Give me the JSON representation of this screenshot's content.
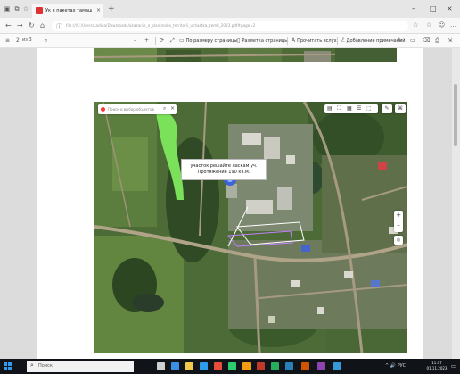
{
  "browser": {
    "tab": {
      "title": "Ук в пакетах тамаш ждй",
      "close": "×"
    },
    "new_tab": "+",
    "window": {
      "minimize": "–",
      "maximize": "□",
      "close": "×"
    },
    "nav": {
      "back": "←",
      "forward": "→",
      "reload": "↻",
      "home": "⌂"
    },
    "url": "file:///C:/Users/Ladina/Downloads/ukazanie_o_planirovke_territorii_uchastka_zemli_2023.pdf#page=2",
    "url_icons": {
      "lock": "ⓘ",
      "star": "☆",
      "collections": "☆"
    },
    "right_icons": {
      "profile": "☺",
      "settings": "…"
    }
  },
  "pdf_toolbar": {
    "menu_glyph": "≡",
    "page_current": "2",
    "page_total": "из 3",
    "search_glyph": "⌕",
    "zoom_out": "–",
    "zoom_in": "+",
    "rotate": "⟳",
    "fit": "⤢",
    "fit_page": "По размеру страницы",
    "page_view": "Разметка страницы",
    "read_aloud": "Прочитать вслух",
    "add_text": "Добавление примечаний",
    "draw": "✎",
    "highlight": "▭",
    "erase": "⌫",
    "print": "⎙",
    "save": "💾",
    "pin": "⇲"
  },
  "map": {
    "search_placeholder": "Поиск и выбор объектов",
    "search_icon": "⌕",
    "clear_icon": "×",
    "label_line1": "участок решайте ласкам уч.",
    "label_line2": "Протяжение 190 кв.м.",
    "zoom_in": "+",
    "zoom_out": "–",
    "locate": "◎",
    "tools": [
      "▤",
      "⛶",
      "▦",
      "☰",
      "⬚"
    ],
    "ruler": "✎",
    "layers": "⌘"
  },
  "taskbar": {
    "search_placeholder": "Поиск",
    "search_icon": "⌕",
    "tray_text": "^ 🔊 РУС",
    "time": "11:07",
    "date": "01.11.2023",
    "notification": "▭"
  },
  "colors": {
    "start_blue": "#2d9cf0",
    "tab_favicon": "#dd3333"
  }
}
